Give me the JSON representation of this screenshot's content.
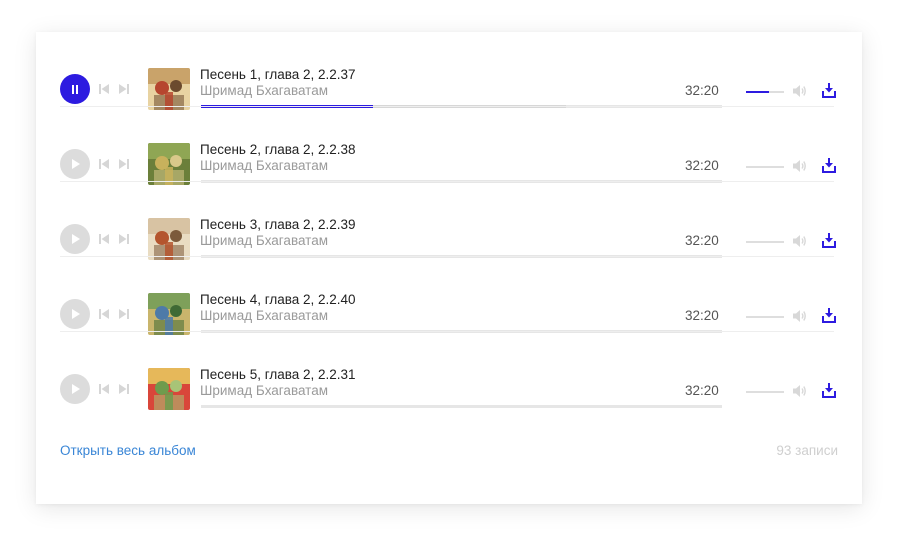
{
  "playlist": {
    "tracks": [
      {
        "title": "Песень 1, глава 2, 2.2.37",
        "artist": "Шримад Бхагаватам",
        "duration": "32:20",
        "playing": true,
        "progress": 0.33,
        "buffered": 0.7,
        "volume": 0.6,
        "cover_colors": [
          "#c9a36a",
          "#b6462f",
          "#e8d3a2",
          "#6b4a2e"
        ]
      },
      {
        "title": "Песень 2, глава 2, 2.2.38",
        "artist": "Шримад Бхагаватам",
        "duration": "32:20",
        "playing": false,
        "progress": 0,
        "buffered": 0,
        "volume": 0,
        "cover_colors": [
          "#8fa654",
          "#c8b15c",
          "#6b7f3a",
          "#d9c98a"
        ]
      },
      {
        "title": "Песень 3, глава 2, 2.2.39",
        "artist": "Шримад Бхагаватам",
        "duration": "32:20",
        "playing": false,
        "progress": 0,
        "buffered": 0,
        "volume": 0,
        "cover_colors": [
          "#d8c3a3",
          "#b4552e",
          "#e9dcc2",
          "#7c5a3b"
        ]
      },
      {
        "title": "Песень 4, глава 2, 2.2.40",
        "artist": "Шримад Бхагаватам",
        "duration": "32:20",
        "playing": false,
        "progress": 0,
        "buffered": 0,
        "volume": 0,
        "cover_colors": [
          "#7ea05a",
          "#4e7aa8",
          "#c9b56c",
          "#3f6a35"
        ]
      },
      {
        "title": "Песень 5, глава 2, 2.2.31",
        "artist": "Шримад Бхагаватам",
        "duration": "32:20",
        "playing": false,
        "progress": 0,
        "buffered": 0,
        "volume": 0,
        "cover_colors": [
          "#e6b85a",
          "#6f9b4d",
          "#d9463a",
          "#a8c477"
        ]
      }
    ]
  },
  "footer": {
    "open_album_label": "Открыть весь альбом",
    "count_label": "93 записи"
  },
  "colors": {
    "accent": "#2d1be0",
    "link": "#3a86d6",
    "inactive_button": "#dcdcdc"
  },
  "icons": {
    "pause": "pause-icon",
    "play": "play-icon",
    "prev": "skip-previous-icon",
    "next": "skip-next-icon",
    "volume": "speaker-icon",
    "download": "download-icon"
  }
}
